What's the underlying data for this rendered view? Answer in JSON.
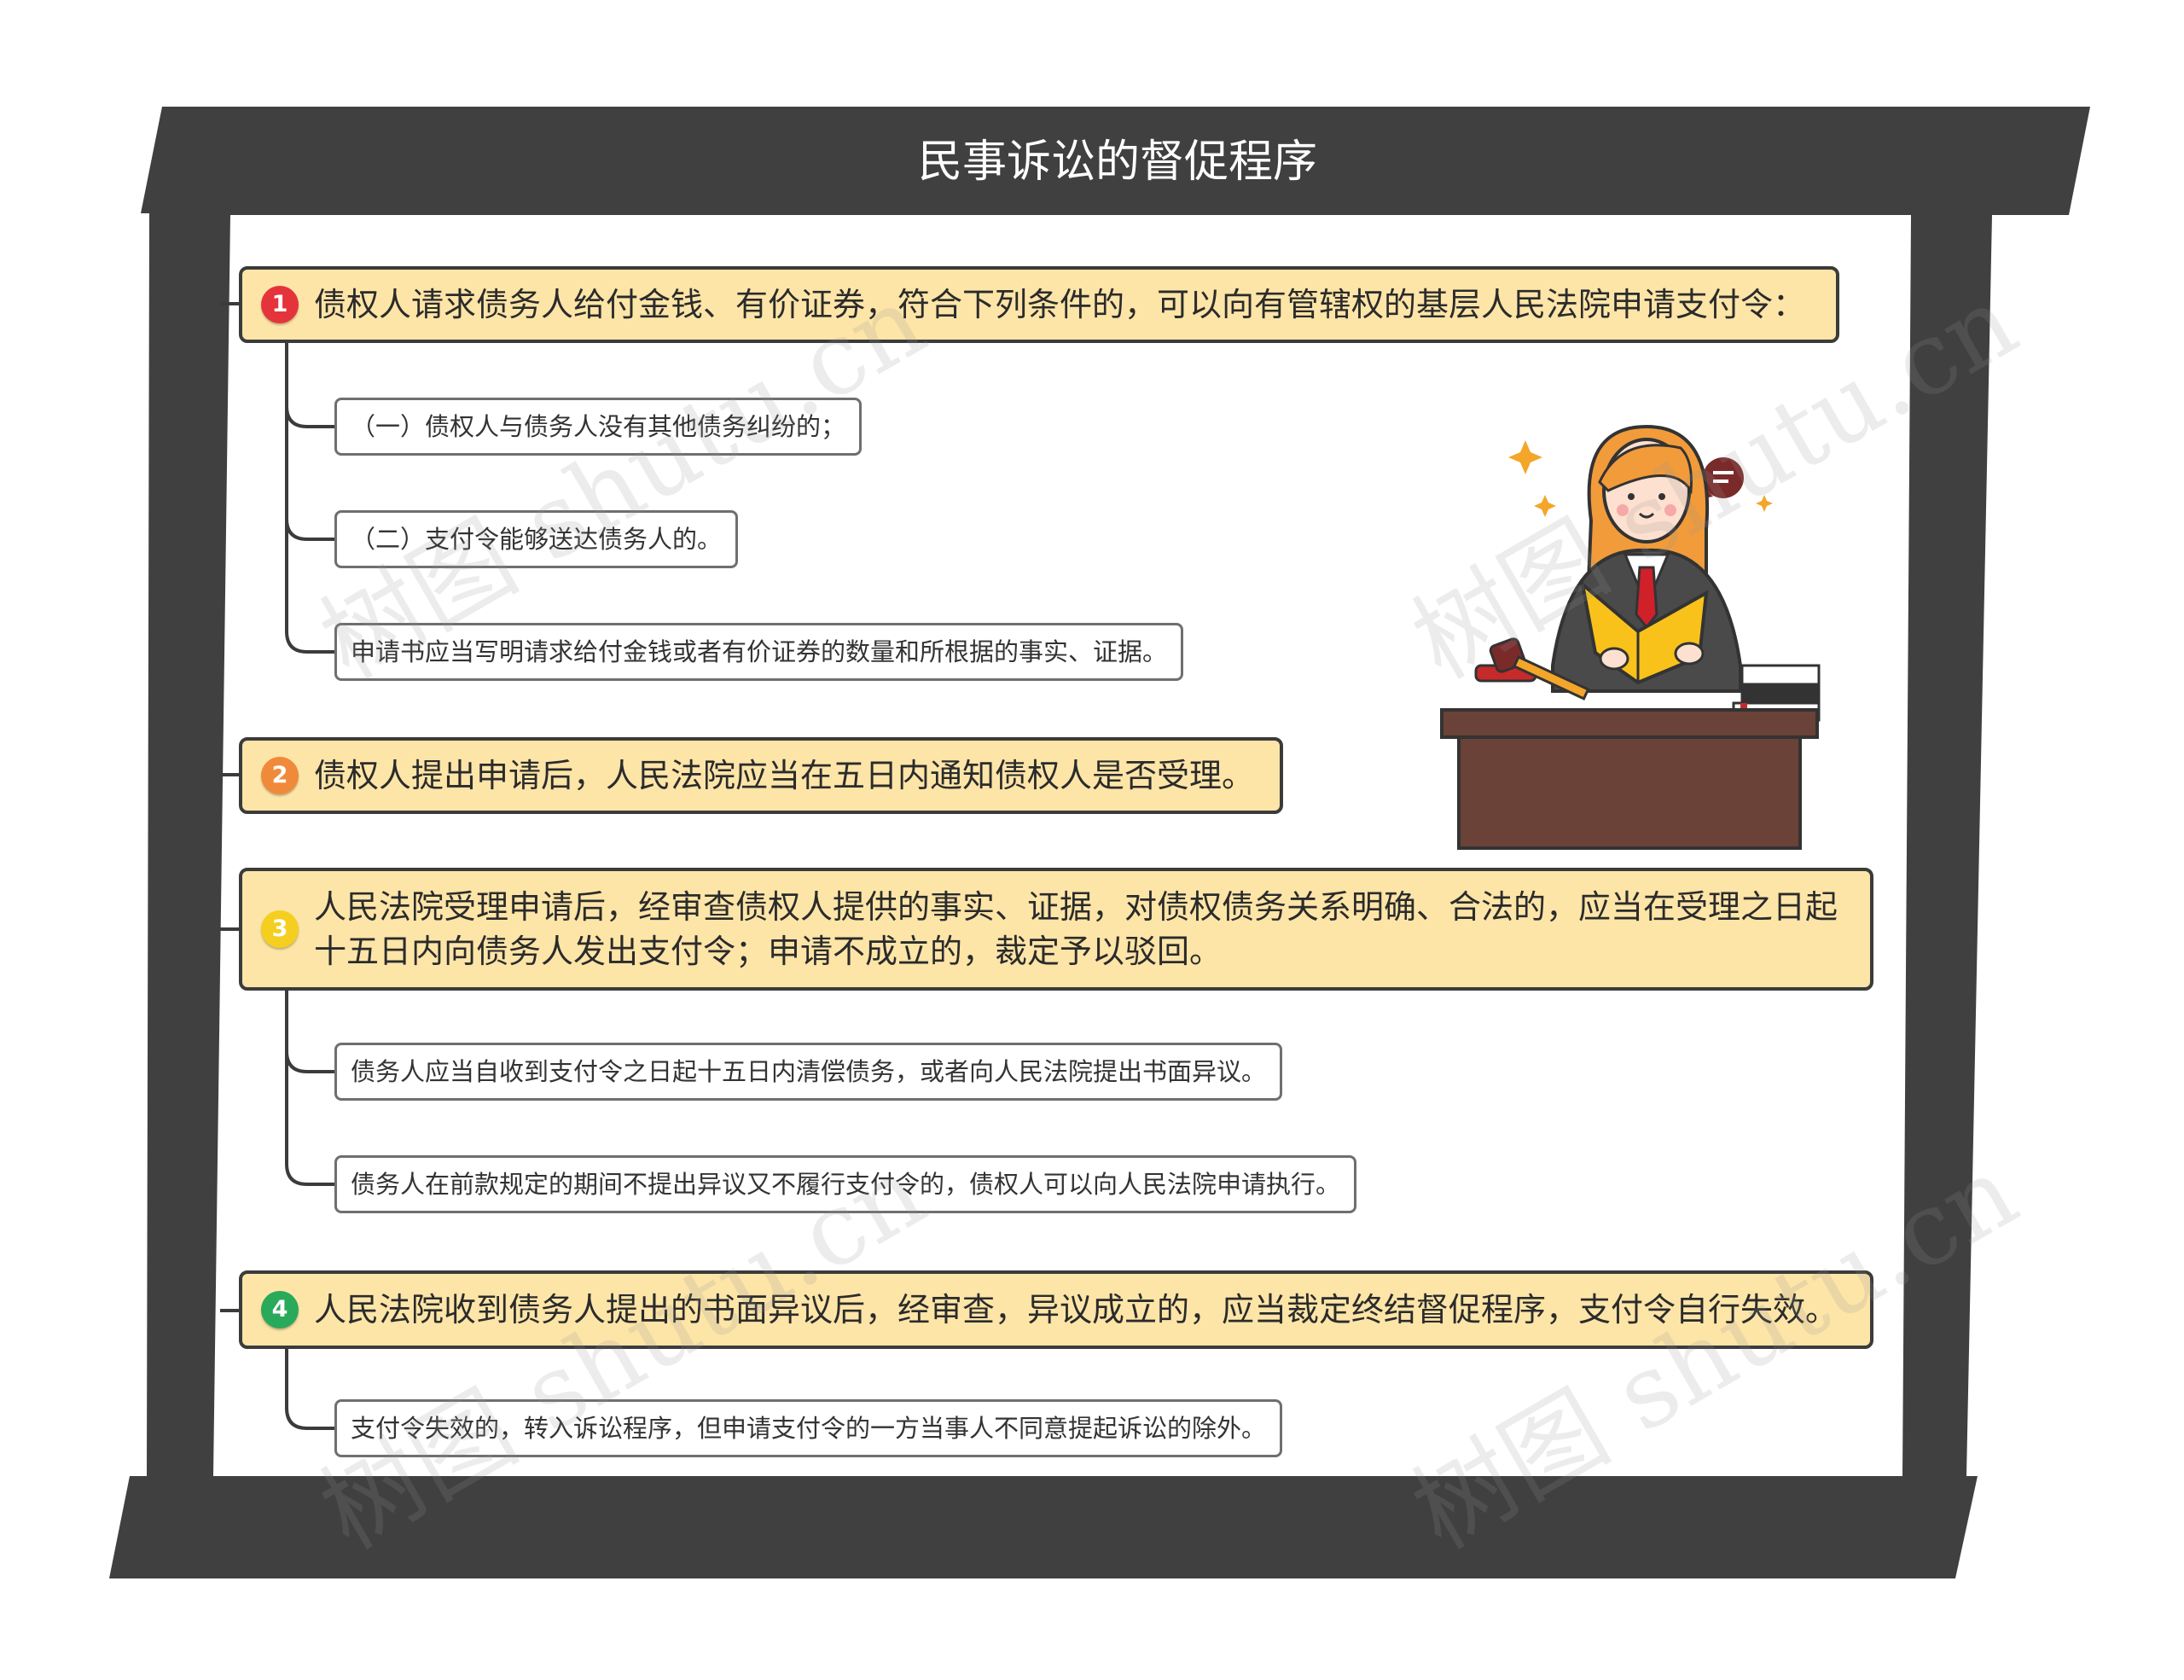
{
  "title": "民事诉讼的督促程序",
  "watermark": "树图 shutu.cn",
  "colors": {
    "frame": "#404040",
    "main_fill": "#fde5a8",
    "badge_1": "#e5333c",
    "badge_2": "#f08a3a",
    "badge_3": "#f4cf1f",
    "badge_4": "#29a95a"
  },
  "nodes": [
    {
      "badge": "1",
      "text": "债权人请求债务人给付金钱、有价证券，符合下列条件的，可以向有管辖权的基层人民法院申请支付令：",
      "children": [
        "（一）债权人与债务人没有其他债务纠纷的；",
        "（二）支付令能够送达债务人的。",
        "申请书应当写明请求给付金钱或者有价证券的数量和所根据的事实、证据。"
      ]
    },
    {
      "badge": "2",
      "text": "债权人提出申请后，人民法院应当在五日内通知债权人是否受理。",
      "children": []
    },
    {
      "badge": "3",
      "text": "人民法院受理申请后，经审查债权人提供的事实、证据，对债权债务关系明确、合法的，应当在受理之日起十五日内向债务人发出支付令；申请不成立的，裁定予以驳回。",
      "children": [
        "债务人应当自收到支付令之日起十五日内清偿债务，或者向人民法院提出书面异议。",
        "债务人在前款规定的期间不提出异议又不履行支付令的，债权人可以向人民法院申请执行。"
      ]
    },
    {
      "badge": "4",
      "text": "人民法院收到债务人提出的书面异议后，经审查，异议成立的，应当裁定终结督促程序，支付令自行失效。",
      "children": [
        "支付令失效的，转入诉讼程序，但申请支付令的一方当事人不同意提起诉讼的除外。"
      ]
    }
  ]
}
